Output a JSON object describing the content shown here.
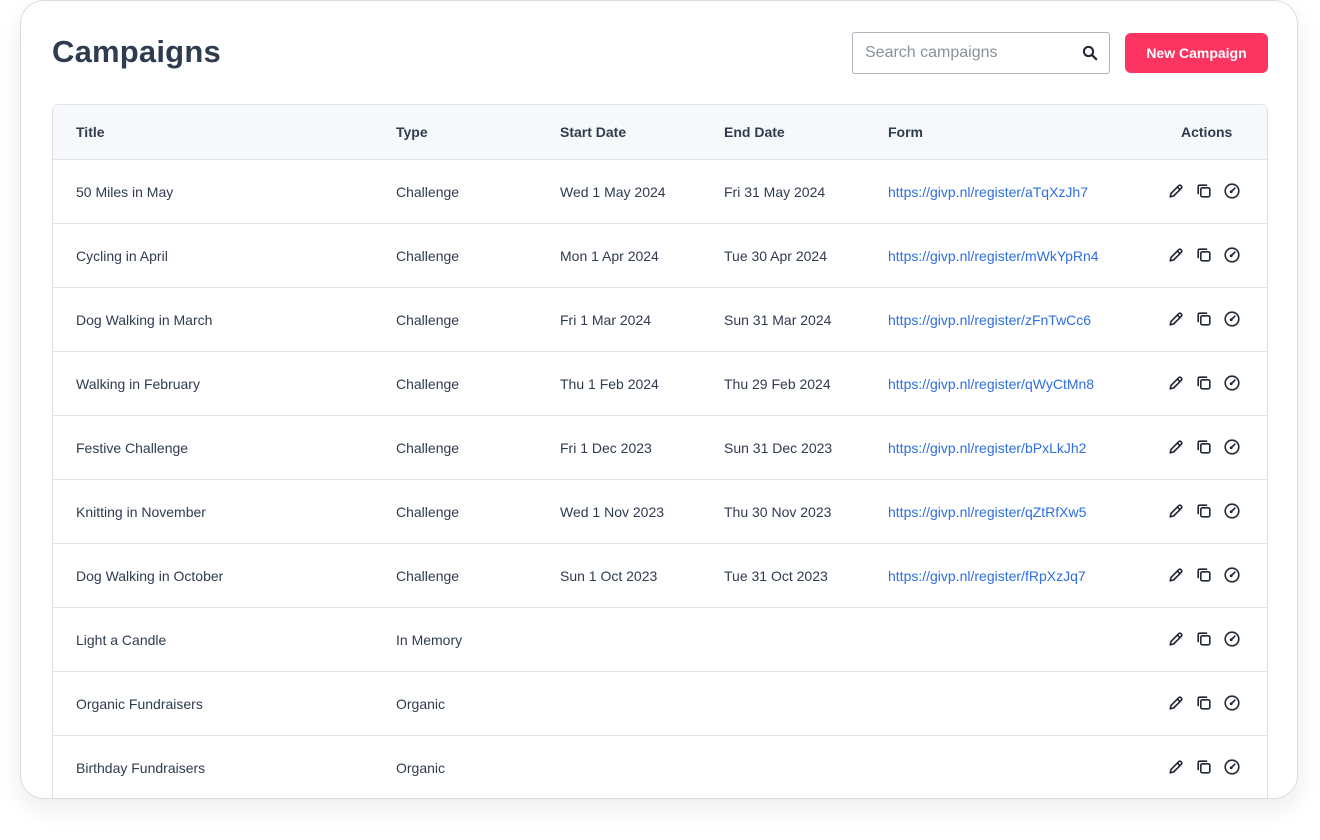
{
  "page": {
    "title": "Campaigns"
  },
  "search": {
    "placeholder": "Search campaigns",
    "value": "",
    "icon": "search-icon"
  },
  "toolbar": {
    "new_campaign_label": "New Campaign",
    "accent_color": "#fb3462"
  },
  "table": {
    "columns": [
      "Title",
      "Type",
      "Start Date",
      "End Date",
      "Form",
      "Actions"
    ],
    "rows": [
      {
        "title": "50 Miles in May",
        "type": "Challenge",
        "start": "Wed 1 May 2024",
        "end": "Fri 31 May 2024",
        "form": "https://givp.nl/register/aTqXzJh7"
      },
      {
        "title": "Cycling in April",
        "type": "Challenge",
        "start": "Mon 1 Apr 2024",
        "end": "Tue 30 Apr 2024",
        "form": "https://givp.nl/register/mWkYpRn4"
      },
      {
        "title": "Dog Walking in March",
        "type": "Challenge",
        "start": "Fri 1 Mar 2024",
        "end": "Sun 31 Mar 2024",
        "form": "https://givp.nl/register/zFnTwCc6"
      },
      {
        "title": "Walking in February",
        "type": "Challenge",
        "start": "Thu 1 Feb 2024",
        "end": "Thu 29 Feb 2024",
        "form": "https://givp.nl/register/qWyCtMn8"
      },
      {
        "title": "Festive Challenge",
        "type": "Challenge",
        "start": "Fri 1 Dec 2023",
        "end": "Sun 31 Dec 2023",
        "form": "https://givp.nl/register/bPxLkJh2"
      },
      {
        "title": "Knitting in November",
        "type": "Challenge",
        "start": "Wed 1 Nov 2023",
        "end": "Thu 30 Nov 2023",
        "form": "https://givp.nl/register/qZtRfXw5"
      },
      {
        "title": "Dog Walking in October",
        "type": "Challenge",
        "start": "Sun 1 Oct 2023",
        "end": "Tue 31 Oct 2023",
        "form": "https://givp.nl/register/fRpXzJq7"
      },
      {
        "title": "Light a Candle",
        "type": "In Memory",
        "start": "",
        "end": "",
        "form": ""
      },
      {
        "title": "Organic Fundraisers",
        "type": "Organic",
        "start": "",
        "end": "",
        "form": ""
      },
      {
        "title": "Birthday Fundraisers",
        "type": "Organic",
        "start": "",
        "end": "",
        "form": ""
      }
    ],
    "row_actions": [
      "edit-icon",
      "copy-icon",
      "dashboard-icon"
    ],
    "link_color": "#2d6fe0"
  }
}
